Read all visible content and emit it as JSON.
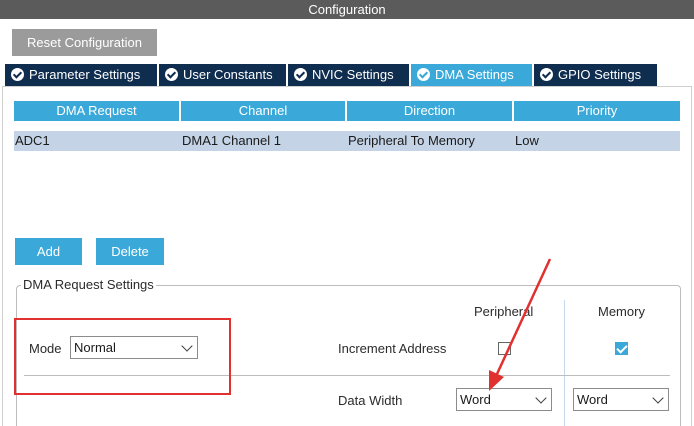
{
  "window": {
    "title": "Configuration"
  },
  "toolbar": {
    "reset_label": "Reset Configuration"
  },
  "tabs": [
    {
      "label": "Parameter Settings",
      "active": false
    },
    {
      "label": "User Constants",
      "active": false
    },
    {
      "label": "NVIC Settings",
      "active": false
    },
    {
      "label": "DMA Settings",
      "active": true
    },
    {
      "label": "GPIO Settings",
      "active": false
    }
  ],
  "dma_table": {
    "headers": [
      "DMA Request",
      "Channel",
      "Direction",
      "Priority"
    ],
    "rows": [
      [
        "ADC1",
        "DMA1 Channel 1",
        "Peripheral To Memory",
        "Low"
      ]
    ]
  },
  "actions": {
    "add_label": "Add",
    "delete_label": "Delete"
  },
  "request_settings": {
    "title": "DMA Request Settings",
    "peripheral_header": "Peripheral",
    "memory_header": "Memory",
    "mode_label": "Mode",
    "mode_value": "Normal",
    "increment_label": "Increment Address",
    "increment_peripheral": false,
    "increment_memory": true,
    "data_width_label": "Data Width",
    "data_width_peripheral": "Word",
    "data_width_memory": "Word"
  },
  "colors": {
    "accent": "#3aa9d9",
    "tab_dark": "#0f2d4f",
    "row_selected": "#c4d4e6",
    "annotation_red": "#e0312f"
  }
}
